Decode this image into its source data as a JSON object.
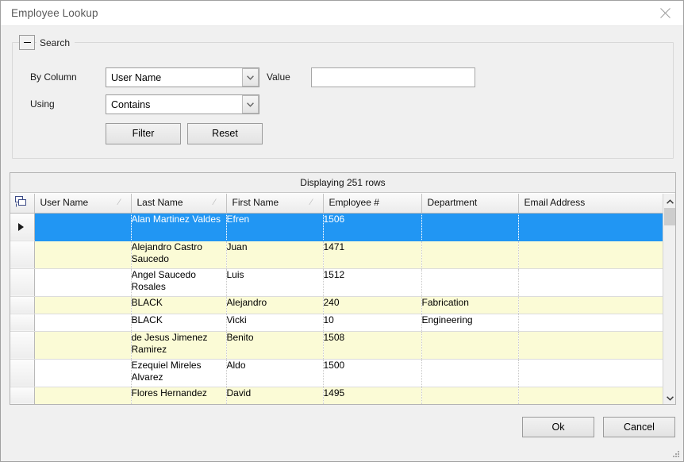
{
  "window": {
    "title": "Employee Lookup",
    "close_icon": "close-icon"
  },
  "search": {
    "legend": "Search",
    "collapse_icon": "minus-icon",
    "by_column_label": "By Column",
    "by_column_value": "User Name",
    "using_label": "Using",
    "using_value": "Contains",
    "value_label": "Value",
    "value_text": "",
    "value_placeholder": "",
    "filter_button": "Filter",
    "reset_button": "Reset",
    "dropdown_icon": "chevron-down-icon"
  },
  "grid": {
    "caption": "Displaying 251 rows",
    "corner_icon": "select-all-icon",
    "sort_glyph": "⁄",
    "columns": [
      "User Name",
      "Last Name",
      "First Name",
      "Employee #",
      "Department",
      "Email Address"
    ],
    "sortable": [
      true,
      true,
      true,
      false,
      false,
      false
    ],
    "rows": [
      {
        "selected": true,
        "alt": false,
        "tall": true,
        "cells": [
          "",
          "Alan Martinez Valdes",
          "Efren",
          "1506",
          "",
          ""
        ]
      },
      {
        "selected": false,
        "alt": true,
        "tall": true,
        "cells": [
          "",
          "Alejandro Castro Saucedo",
          "Juan",
          "1471",
          "",
          ""
        ]
      },
      {
        "selected": false,
        "alt": false,
        "tall": true,
        "cells": [
          "",
          "Angel Saucedo Rosales",
          "Luis",
          "1512",
          "",
          ""
        ]
      },
      {
        "selected": false,
        "alt": true,
        "tall": false,
        "cells": [
          "",
          "BLACK",
          "Alejandro",
          "240",
          "Fabrication",
          ""
        ]
      },
      {
        "selected": false,
        "alt": false,
        "tall": false,
        "cells": [
          "",
          "BLACK",
          "Vicki",
          "10",
          "Engineering",
          ""
        ]
      },
      {
        "selected": false,
        "alt": true,
        "tall": true,
        "cells": [
          "",
          "de Jesus Jimenez Ramirez",
          "Benito",
          "1508",
          "",
          ""
        ]
      },
      {
        "selected": false,
        "alt": false,
        "tall": true,
        "cells": [
          "",
          "Ezequiel Mireles Alvarez",
          "Aldo",
          "1500",
          "",
          ""
        ]
      },
      {
        "selected": false,
        "alt": true,
        "tall": false,
        "cells": [
          "",
          "Flores Hernandez",
          "David",
          "1495",
          "",
          ""
        ]
      }
    ],
    "scrollbar": {
      "up_icon": "chevron-up-icon",
      "down_icon": "chevron-down-icon"
    }
  },
  "footer": {
    "ok_button": "Ok",
    "cancel_button": "Cancel",
    "resize_grip_icon": "resize-grip-icon"
  },
  "colors": {
    "selection": "#2196f3",
    "alt_row": "#fbfbd6",
    "window_bg": "#f0f0f0",
    "title_bg": "#ffffff"
  }
}
